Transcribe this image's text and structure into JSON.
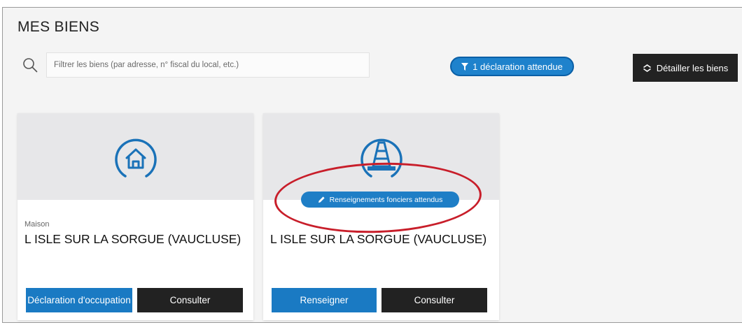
{
  "page": {
    "title": "MES BIENS"
  },
  "search": {
    "placeholder": "Filtrer les biens (par adresse, n° fiscal du local, etc.)",
    "value": ""
  },
  "filter_badge": {
    "label": "1 déclaration attendue",
    "icon": "filter-icon"
  },
  "detail_button": {
    "label": "Détailler les biens",
    "icon": "expand-collapse-icon"
  },
  "cards": [
    {
      "icon": "house-icon",
      "type": "Maison",
      "location": "L ISLE SUR LA SORGUE   (VAUCLUSE)",
      "actions": [
        "Déclaration d'occupation",
        "Consulter"
      ]
    },
    {
      "icon": "traffic-cone-icon",
      "status": "Renseignements fonciers attendus",
      "status_icon": "pencil-icon",
      "location": "L ISLE SUR LA SORGUE   (VAUCLUSE)",
      "actions": [
        "Renseigner",
        "Consulter"
      ]
    }
  ],
  "colors": {
    "accent": "#1a7ac3",
    "dark_button": "#222222",
    "annotation": "#c81e2a"
  }
}
